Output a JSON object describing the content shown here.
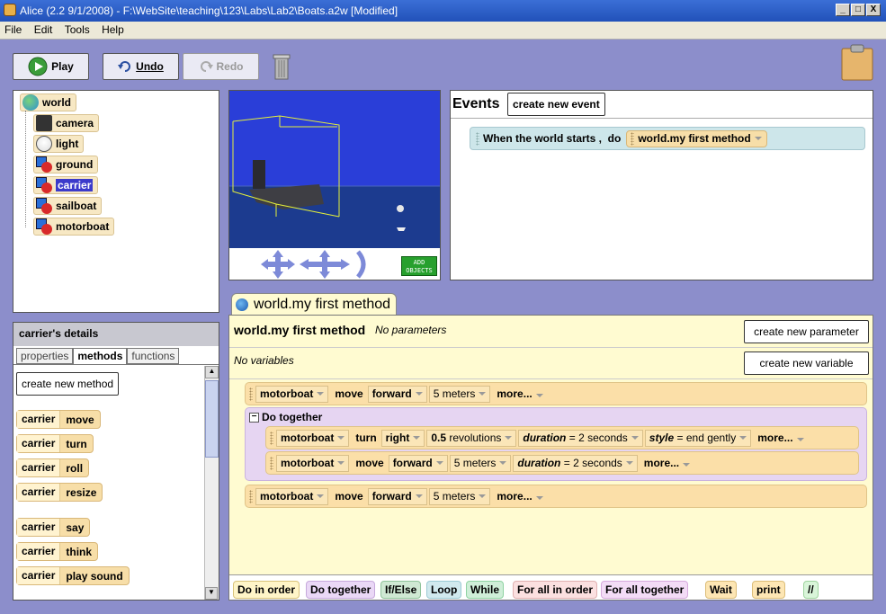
{
  "window": {
    "title": "Alice (2.2  9/1/2008) - F:\\WebSite\\teaching\\123\\Labs\\Lab2\\Boats.a2w [Modified]",
    "min": "_",
    "max": "□",
    "close": "X"
  },
  "menu": [
    "File",
    "Edit",
    "Tools",
    "Help"
  ],
  "toolbar": {
    "play": "Play",
    "undo": "Undo",
    "redo": "Redo"
  },
  "tree": {
    "root": "world",
    "items": [
      "camera",
      "light",
      "ground",
      "carrier",
      "sailboat",
      "motorboat"
    ],
    "selected": "carrier"
  },
  "details": {
    "title": "carrier's details",
    "tabs": [
      "properties",
      "methods",
      "functions"
    ],
    "active_tab": "methods",
    "create_method": "create new method",
    "methods": [
      {
        "obj": "carrier",
        "name": "move"
      },
      {
        "obj": "carrier",
        "name": "turn"
      },
      {
        "obj": "carrier",
        "name": "roll"
      },
      {
        "obj": "carrier",
        "name": "resize"
      },
      {
        "obj": "carrier",
        "name": "say"
      },
      {
        "obj": "carrier",
        "name": "think"
      },
      {
        "obj": "carrier",
        "name": "play sound"
      }
    ]
  },
  "scene": {
    "add_objects": "ADD OBJECTS"
  },
  "events": {
    "title": "Events",
    "create_event": "create new event",
    "when": "When the world starts ,  do",
    "method": "world.my first method"
  },
  "editor": {
    "tab": "world.my first method",
    "method_name": "world.my first method",
    "params_text": "No parameters",
    "create_param": "create new parameter",
    "vars_text": "No variables",
    "create_var": "create new variable",
    "do_together": "Do together",
    "line1": {
      "obj": "motorboat",
      "verb": "move",
      "dir": "forward",
      "amount": "5 meters",
      "more": "more..."
    },
    "line2": {
      "obj": "motorboat",
      "verb": "turn",
      "dir": "right",
      "amount_num": "0.5",
      "amount_unit": "revolutions",
      "dur_label": "duration",
      "dur_eq": "= 2",
      "dur_unit": "seconds",
      "style_label": "style",
      "style_val": "= end gently",
      "more": "more..."
    },
    "line3": {
      "obj": "motorboat",
      "verb": "move",
      "dir": "forward",
      "amount": "5 meters",
      "dur_label": "duration",
      "dur_eq": "= 2",
      "dur_unit": "seconds",
      "more": "more..."
    },
    "line4": {
      "obj": "motorboat",
      "verb": "move",
      "dir": "forward",
      "amount": "5 meters",
      "more": "more..."
    }
  },
  "controls": [
    "Do in order",
    "Do together",
    "If/Else",
    "Loop",
    "While",
    "For all in order",
    "For all together",
    "Wait",
    "print",
    "//"
  ]
}
